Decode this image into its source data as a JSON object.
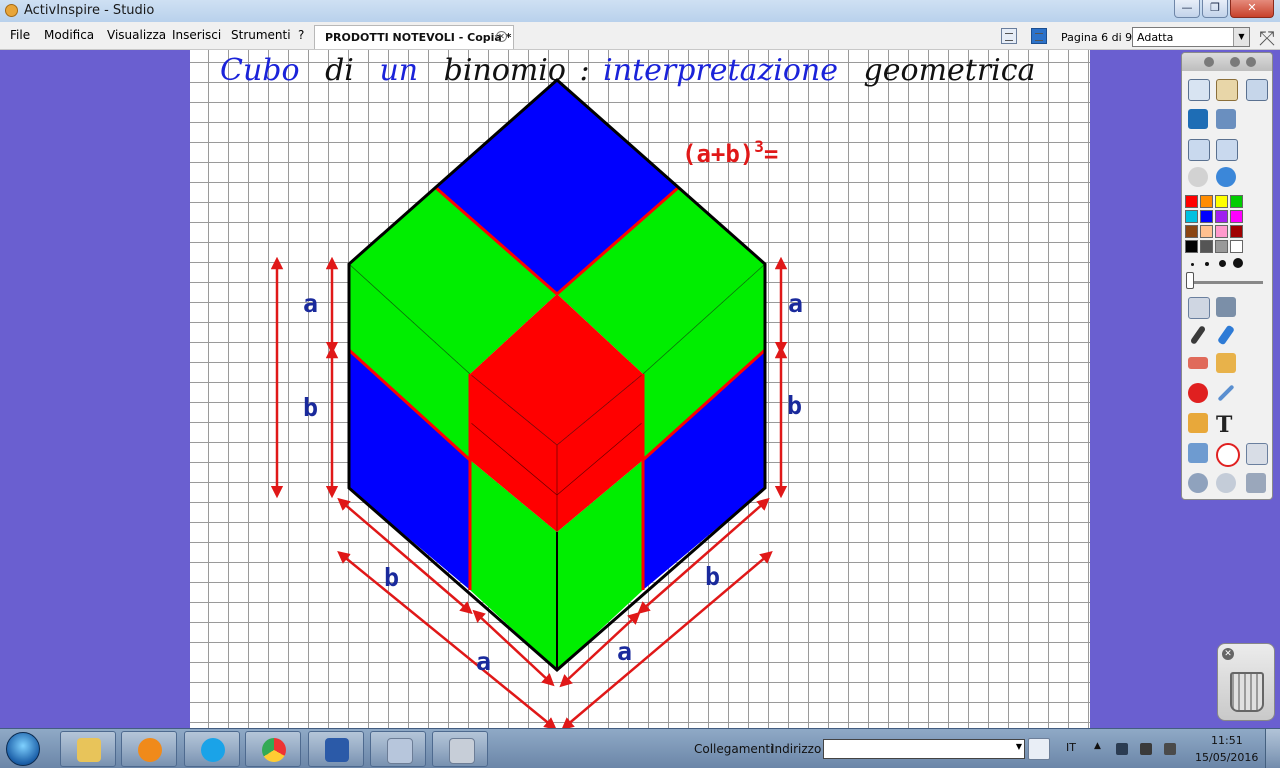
{
  "window": {
    "title": "ActivInspire - Studio"
  },
  "menu": {
    "items": [
      "File",
      "Modifica",
      "Visualizza",
      "Inserisci",
      "Strumenti",
      "?"
    ]
  },
  "tab": {
    "label": "PRODOTTI NOTEVOLI - Copia *"
  },
  "page": {
    "label": "Pagina 6 di 9",
    "zoom": "Adatta"
  },
  "slide": {
    "title_words": [
      {
        "text": "Cubo",
        "color": "#1a23d9"
      },
      {
        "text": "di",
        "color": "#111111"
      },
      {
        "text": "un",
        "color": "#1a23d9"
      },
      {
        "text": "binomio",
        "color": "#111111"
      },
      {
        "text": ":",
        "color": "#111111"
      },
      {
        "text": "interpretazione",
        "color": "#1a23d9"
      },
      {
        "text": "geometrica",
        "color": "#111111"
      }
    ],
    "formula": {
      "base": "(a+b)",
      "exponent": "3",
      "suffix": "="
    },
    "labels": {
      "a": "a",
      "b": "b"
    },
    "colors": {
      "blue": "#0000ff",
      "green": "#00ee00",
      "red": "#ff0000",
      "label": "#1a2a9c",
      "arrow": "#e01818"
    }
  },
  "palette": [
    "#ff0000",
    "#ff8c00",
    "#ffff00",
    "#00cc00",
    "#00c0e0",
    "#0000ff",
    "#a020f0",
    "#ff00ff",
    "#8b4513",
    "#ffc090",
    "#ff99cc",
    "#a00000",
    "#000000",
    "#555555",
    "#999999",
    "#ffffff"
  ],
  "taskbar": {
    "links_label": "Collegamenti",
    "address_label": "Indirizzo",
    "language": "IT",
    "time": "11:51",
    "date": "15/05/2016",
    "apps": [
      "explorer-icon",
      "media-player-icon",
      "skype-icon",
      "chrome-icon",
      "word-icon",
      "mail-icon",
      "activinspire-icon"
    ]
  }
}
